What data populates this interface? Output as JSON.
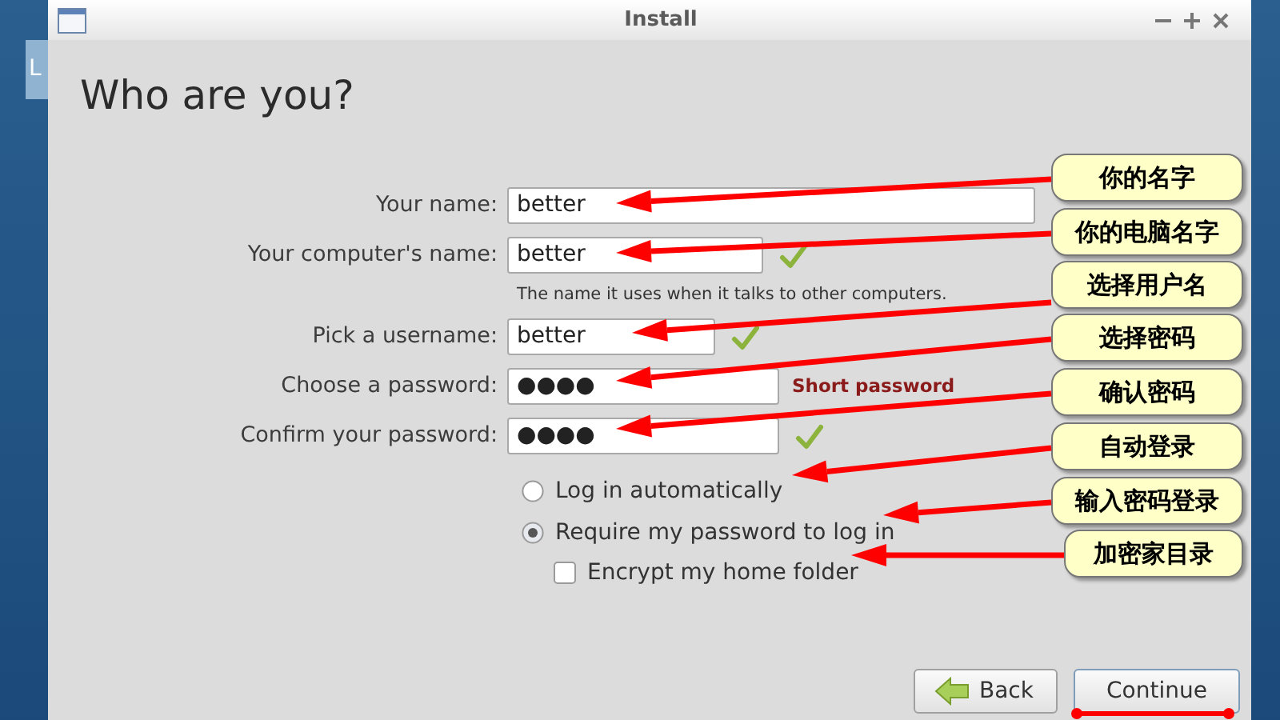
{
  "background_window": {
    "label": "L"
  },
  "window": {
    "title": "Install"
  },
  "heading": "Who are you?",
  "fields": [
    {
      "label": "Your name:",
      "value": "better",
      "valid": false
    },
    {
      "label": "Your computer's name:",
      "value": "better",
      "valid": true,
      "hint": "The name it uses when it talks to other computers."
    },
    {
      "label": "Pick a username:",
      "value": "better",
      "valid": true
    },
    {
      "label": "Choose a password:",
      "value": "●●●●",
      "valid": false,
      "message": "Short password"
    },
    {
      "label": "Confirm your password:",
      "value": "●●●●",
      "valid": true
    }
  ],
  "login_options": [
    {
      "label": "Log in automatically",
      "selected": false
    },
    {
      "label": "Require my password to log in",
      "selected": true
    }
  ],
  "encrypt": {
    "label": "Encrypt my home folder",
    "checked": false
  },
  "buttons": [
    {
      "label": "Back",
      "kind": "back"
    },
    {
      "label": "Continue",
      "kind": "continue"
    }
  ],
  "annotations": [
    {
      "text": "你的名字"
    },
    {
      "text": "你的电脑名字"
    },
    {
      "text": "选择用户名"
    },
    {
      "text": "选择密码"
    },
    {
      "text": "确认密码"
    },
    {
      "text": "自动登录"
    },
    {
      "text": "输入密码登录"
    },
    {
      "text": "加密家目录"
    }
  ]
}
